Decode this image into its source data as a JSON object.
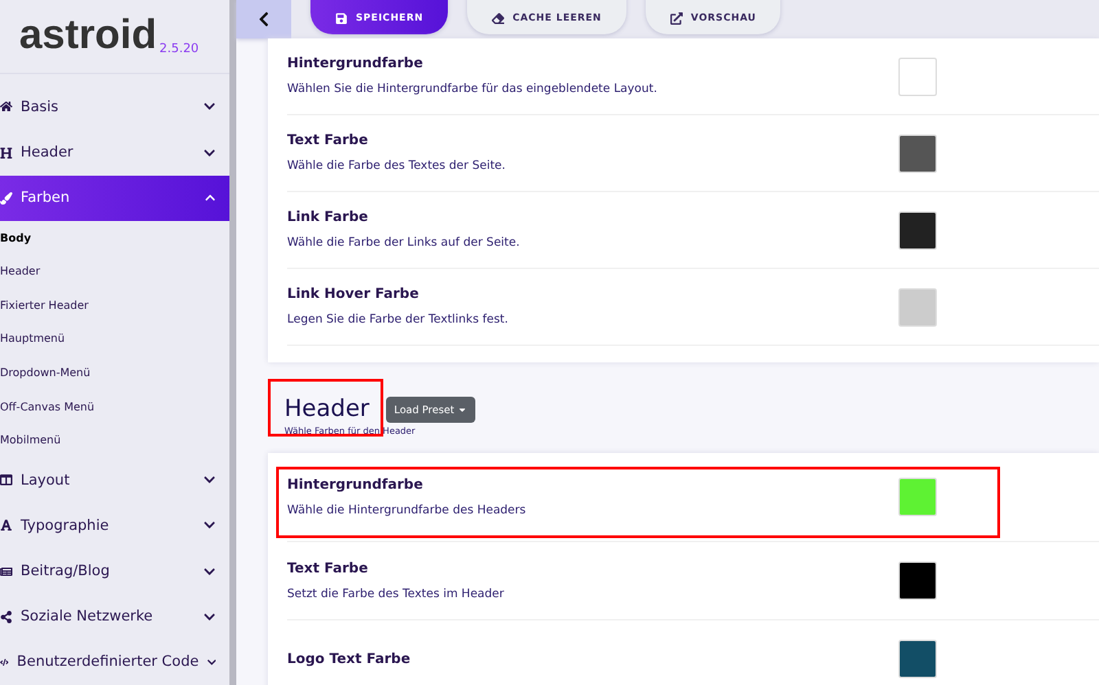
{
  "logo": {
    "name": "astroid",
    "version": "2.5.20"
  },
  "sidebar": {
    "items": [
      {
        "label": "Basis",
        "selected": false,
        "expanded": false
      },
      {
        "label": "Header",
        "selected": false,
        "expanded": false
      },
      {
        "label": "Farben",
        "selected": true,
        "expanded": true,
        "children": [
          {
            "label": "Body",
            "selected": true
          },
          {
            "label": "Header",
            "selected": false
          },
          {
            "label": "Fixierter Header",
            "selected": false
          },
          {
            "label": "Hauptmenü",
            "selected": false
          },
          {
            "label": "Dropdown-Menü",
            "selected": false
          },
          {
            "label": "Off-Canvas Menü",
            "selected": false
          },
          {
            "label": "Mobilmenü",
            "selected": false
          }
        ]
      },
      {
        "label": "Layout",
        "selected": false,
        "expanded": false
      },
      {
        "label": "Typographie",
        "selected": false,
        "expanded": false
      },
      {
        "label": "Beitrag/Blog",
        "selected": false,
        "expanded": false
      },
      {
        "label": "Soziale Netzwerke",
        "selected": false,
        "expanded": false
      },
      {
        "label": "Benutzerdefinierter Code",
        "selected": false,
        "expanded": false
      }
    ]
  },
  "toolbar": {
    "buttons": [
      {
        "label": "SPEICHERN",
        "kind": "primary"
      },
      {
        "label": "CACHE LEEREN",
        "kind": "secondary"
      },
      {
        "label": "VORSCHAU",
        "kind": "secondary"
      }
    ]
  },
  "sections": [
    {
      "rows": [
        {
          "title": "Hintergrundfarbe",
          "description": "Wählen Sie die Hintergrundfarbe für das eingeblendete Layout.",
          "color": "#ffffff",
          "highlighted": false
        },
        {
          "title": "Text Farbe",
          "description": "Wähle die Farbe des Textes der Seite.",
          "color": "#555555",
          "highlighted": false
        },
        {
          "title": "Link Farbe",
          "description": "Wähle die Farbe der Links auf der Seite.",
          "color": "#222222",
          "highlighted": false
        },
        {
          "title": "Link Hover Farbe",
          "description": "Legen Sie die Farbe der Textlinks fest.",
          "color": "#cccccc",
          "highlighted": false
        }
      ]
    },
    {
      "title": "Header",
      "title_highlighted": true,
      "preset_button": "Load Preset",
      "subtitle": "Wähle Farben für den Header",
      "rows": [
        {
          "title": "Hintergrundfarbe",
          "description": "Wähle die Hintergrundfarbe des Headers",
          "color": "#5ef233",
          "highlighted": true
        },
        {
          "title": "Text Farbe",
          "description": "Setzt die Farbe des Textes im Header",
          "color": "#000000",
          "highlighted": false
        },
        {
          "title": "Logo Text Farbe",
          "color": "#124e66",
          "highlighted": false
        }
      ]
    }
  ]
}
